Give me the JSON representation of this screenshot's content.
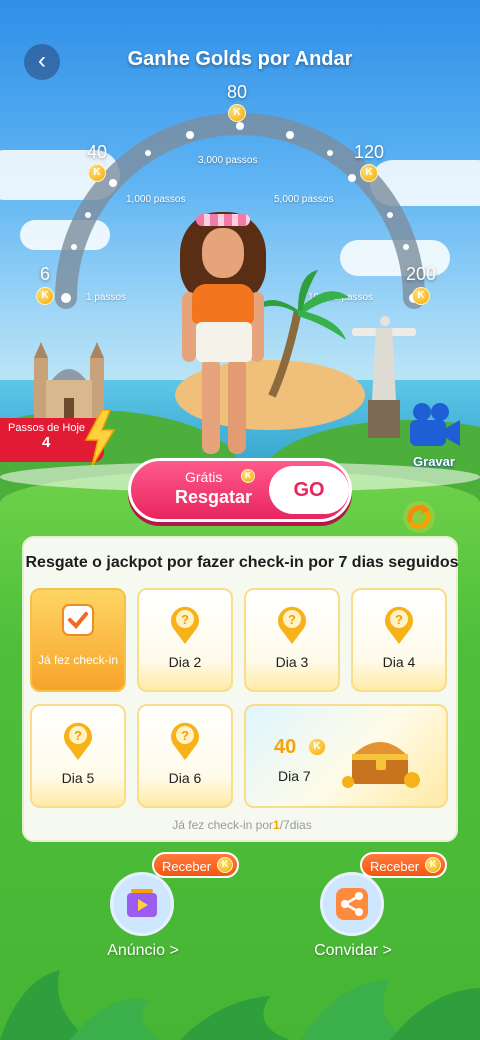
{
  "header": {
    "title": "Ganhe Golds por Andar"
  },
  "gauge": {
    "milestones": [
      {
        "reward": "6",
        "steps": "1 passos"
      },
      {
        "reward": "40",
        "steps": "1,000 passos"
      },
      {
        "reward": "80",
        "steps": "3,000 passos"
      },
      {
        "reward": "120",
        "steps": "5,000 passos"
      },
      {
        "reward": "200",
        "steps": "10,000 passos"
      }
    ],
    "coin_symbol": "K"
  },
  "today": {
    "label": "Passos de Hoje",
    "value": "4"
  },
  "record": {
    "label": "Gravar"
  },
  "claim": {
    "free_label": "Grátis",
    "button_label": "Resgatar",
    "go_label": "GO"
  },
  "checkin": {
    "title": "Resgate o jackpot por fazer check-in por 7 dias seguidos",
    "days": [
      {
        "label": "Já fez check-in",
        "state": "done"
      },
      {
        "label": "Dia 2",
        "state": "pending"
      },
      {
        "label": "Dia 3",
        "state": "pending"
      },
      {
        "label": "Dia 4",
        "state": "pending"
      },
      {
        "label": "Dia 5",
        "state": "pending"
      },
      {
        "label": "Dia 6",
        "state": "pending"
      }
    ],
    "day7": {
      "label": "Dia 7",
      "amount": "40"
    },
    "progress_prefix": "Já fez check-in por",
    "progress_done": "1",
    "progress_suffix": "/7dias"
  },
  "actions": [
    {
      "label": "Anúncio >",
      "badge": "Receber",
      "icon": "video-icon"
    },
    {
      "label": "Convidar >",
      "badge": "Receber",
      "icon": "share-icon"
    }
  ],
  "colors": {
    "accent": "#e8255f",
    "gold": "#f5a30d",
    "green": "#46b534"
  }
}
